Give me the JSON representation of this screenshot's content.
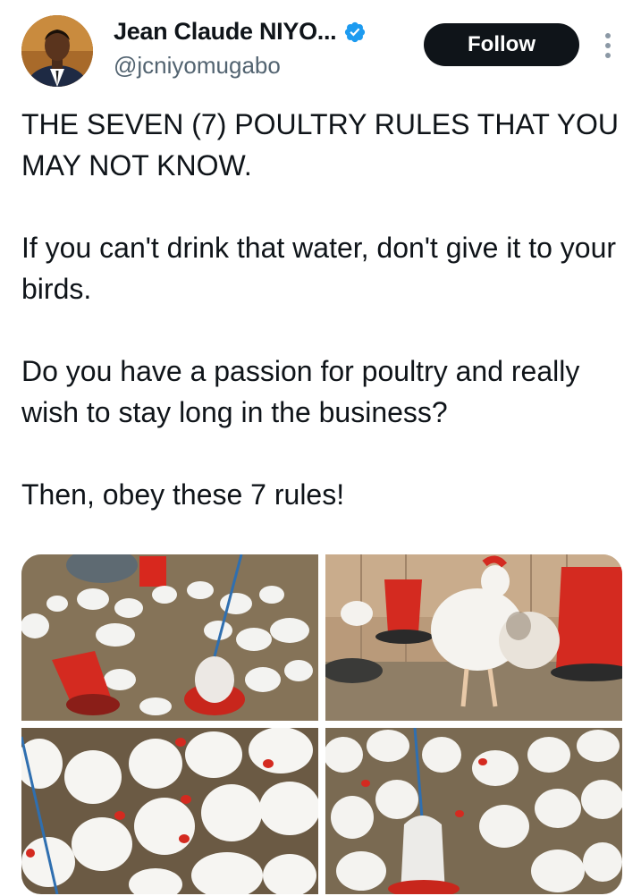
{
  "author": {
    "display_name": "Jean Claude NIYO...",
    "handle": "@jcniyomugabo",
    "verified": true,
    "verified_color": "#1d9bf0"
  },
  "actions": {
    "follow_label": "Follow",
    "more_icon": "more-vertical-icon"
  },
  "tweet": {
    "paragraphs": [
      "THE SEVEN (7) POULTRY RULES THAT YOU MAY NOT KNOW.",
      "If you can't drink that water, don't give it to your birds.",
      "Do you have a passion for poultry and really wish to stay long in the business?",
      "Then, obey these 7 rules!"
    ]
  },
  "media": {
    "count": 4,
    "photos": [
      "chickens-with-red-feeders-photo",
      "large-hen-with-red-feeder-photo",
      "white-broiler-chickens-photo",
      "chickens-around-drinker-photo"
    ]
  }
}
